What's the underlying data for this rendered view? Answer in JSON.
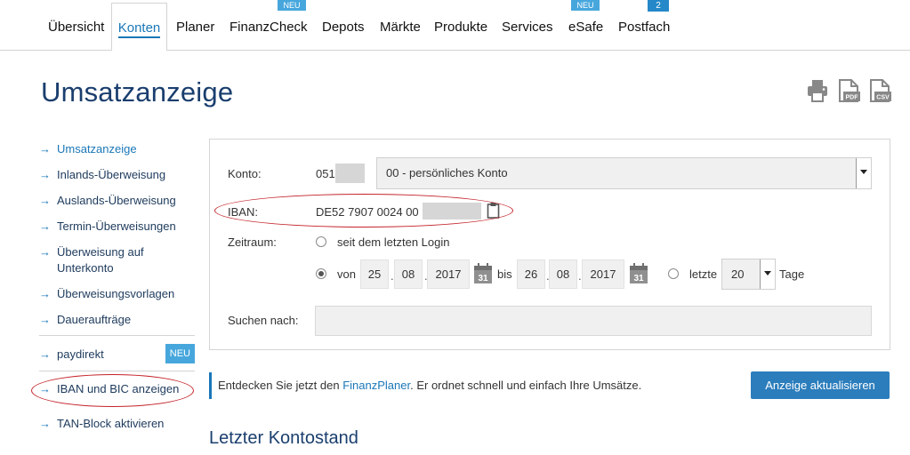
{
  "nav": {
    "items": [
      {
        "label": "Übersicht"
      },
      {
        "label": "Konten"
      },
      {
        "label": "Planer"
      },
      {
        "label": "FinanzCheck",
        "badge": "NEU"
      },
      {
        "label": "Depots"
      },
      {
        "label": "Märkte"
      },
      {
        "label": "Produkte"
      },
      {
        "label": "Services"
      },
      {
        "label": "eSafe",
        "badge": "NEU"
      },
      {
        "label": "Postfach",
        "badge": "2"
      }
    ],
    "active": "Konten"
  },
  "page": {
    "title": "Umsatzanzeige"
  },
  "toolbar": {
    "icons": [
      "print-icon",
      "pdf-icon",
      "csv-icon"
    ],
    "pdf_label": "PDF",
    "csv_label": "CSV"
  },
  "sidebar": {
    "items": [
      {
        "label": "Umsatzanzeige",
        "active": true
      },
      {
        "label": "Inlands-Überweisung"
      },
      {
        "label": "Auslands-Überweisung"
      },
      {
        "label": "Termin-Überweisungen"
      },
      {
        "label": "Überweisung auf Unterkonto"
      },
      {
        "label": "Überweisungsvorlagen"
      },
      {
        "label": "Daueraufträge"
      },
      {
        "label": "paydirekt",
        "badge": "NEU"
      },
      {
        "label": "IBAN und BIC anzeigen"
      },
      {
        "label": "TAN-Block aktivieren"
      }
    ]
  },
  "form": {
    "konto_label": "Konto:",
    "konto_prefix": "051",
    "konto_select": "00 - persönliches Konto",
    "iban_label": "IBAN:",
    "iban_value": "DE52 7907 0024 00",
    "zeitraum_label": "Zeitraum:",
    "option_login": "seit dem letzten Login",
    "von_label": "von",
    "from_day": "25",
    "from_month": "08",
    "from_year": "2017",
    "bis_label": "bis",
    "to_day": "26",
    "to_month": "08",
    "to_year": "2017",
    "letzte_label": "letzte",
    "letzte_value": "20",
    "tage_label": "Tage",
    "calendar_day": "31",
    "search_label": "Suchen nach:",
    "search_value": ""
  },
  "info": {
    "text_before": "Entdecken Sie jetzt den",
    "link": "FinanzPlaner",
    "text_after": ". Er ordnet schnell und einfach Ihre Umsätze."
  },
  "buttons": {
    "update": "Anzeige aktualisieren"
  },
  "section": {
    "title": "Letzter Kontostand"
  },
  "colors": {
    "accent": "#1a77b8",
    "heading": "#1a3e6e",
    "badge": "#47a7dd",
    "button": "#2b7dbc",
    "highlight": "#c4232a"
  }
}
